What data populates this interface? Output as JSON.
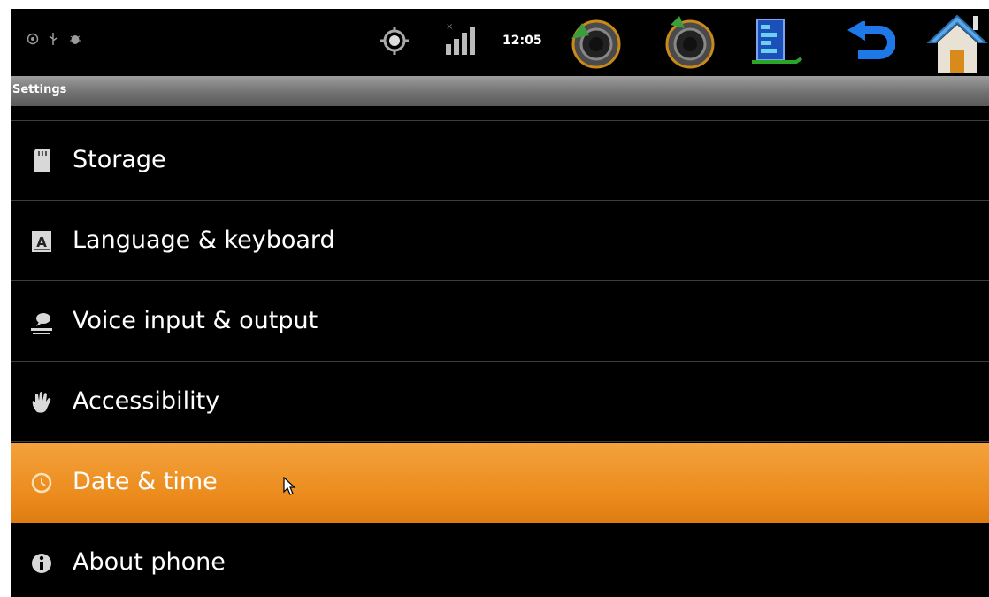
{
  "status_bar": {
    "time": "12:05",
    "notification_icons": [
      "notification-icon",
      "usb-icon",
      "debug-icon"
    ]
  },
  "title_bar": {
    "title": "Settings"
  },
  "settings_items": [
    {
      "label": "Storage",
      "icon": "sd-card-icon",
      "selected": false
    },
    {
      "label": "Language & keyboard",
      "icon": "keyboard-icon",
      "selected": false
    },
    {
      "label": "Voice input & output",
      "icon": "voice-icon",
      "selected": false
    },
    {
      "label": "Accessibility",
      "icon": "hand-icon",
      "selected": false
    },
    {
      "label": "Date & time",
      "icon": "clock-icon",
      "selected": true
    },
    {
      "label": "About phone",
      "icon": "info-icon",
      "selected": false
    }
  ],
  "colors": {
    "highlight": "#eb8a1b",
    "background": "#000000",
    "text": "#ffffff"
  }
}
